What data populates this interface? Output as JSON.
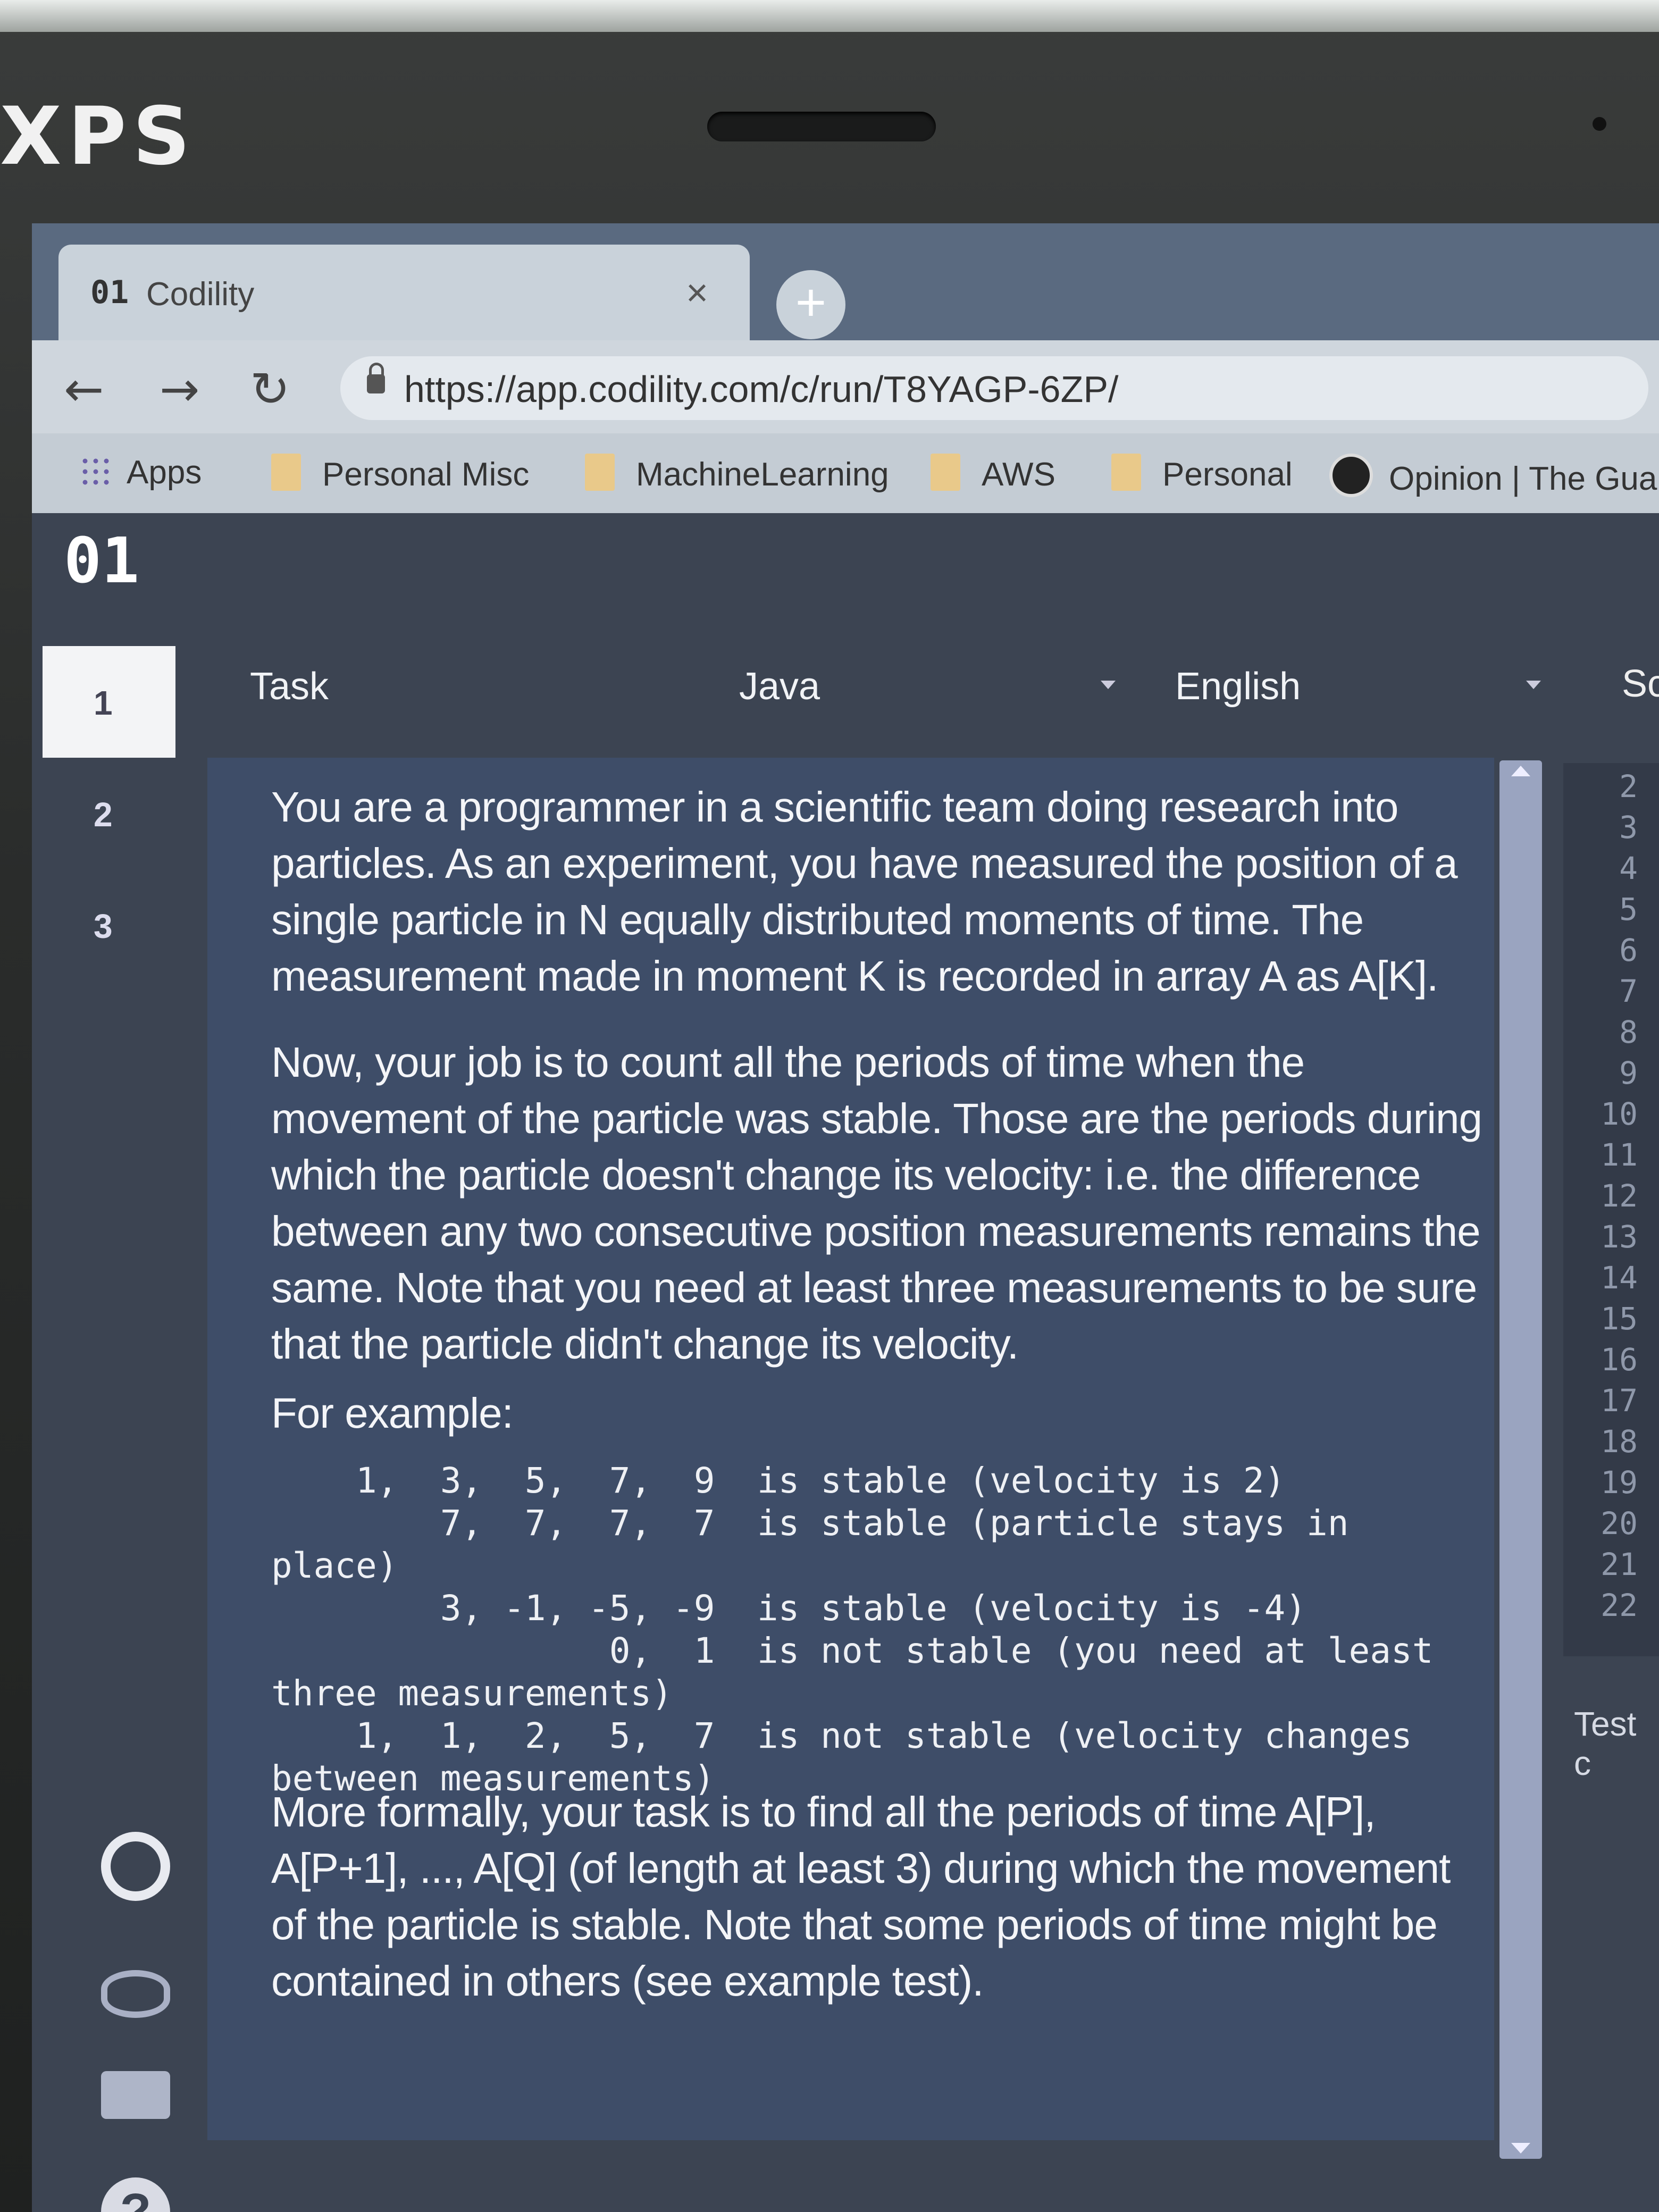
{
  "device": {
    "brand": "XPS"
  },
  "browser": {
    "tab": {
      "favicon_text": "01",
      "title": "Codility"
    },
    "address": {
      "url": "https://app.codility.com/c/run/T8YAGP-6ZP/"
    },
    "bookmarks": [
      "Apps",
      "Personal Misc",
      "MachineLearning",
      "AWS",
      "Personal",
      "Opinion | The Guar"
    ]
  },
  "app": {
    "logo": "01",
    "task_numbers": [
      "1",
      "2",
      "3"
    ],
    "header": {
      "task_label": "Task",
      "language": "Java",
      "locale": "English",
      "right_cut": "Sc"
    },
    "task_text": {
      "p1": "You are a programmer in a scientific team doing research into particles. As an experiment, you have measured the position of a single particle in N equally distributed moments of time. The measurement made in moment K is recorded in array A as A[K].",
      "p2": "Now, your job is to count all the periods of time when the movement of the particle was stable. Those are the periods during which the particle doesn't change its velocity: i.e. the difference between any two consecutive position measurements remains the same. Note that you need at least three measurements to be sure that the particle didn't change its velocity.",
      "p3": "For example:",
      "examples": "    1,  3,  5,  7,  9  is stable (velocity is 2)\n        7,  7,  7,  7  is stable (particle stays in\nplace)\n        3, -1, -5, -9  is stable (velocity is -4)\n                0,  1  is not stable (you need at least\nthree measurements)\n    1,  1,  2,  5,  7  is not stable (velocity changes\nbetween measurements)",
      "p4": "More formally, your task is to find all the periods of time A[P], A[P+1], ..., A[Q] (of length at least 3) during which the movement of the particle is stable. Note that some periods of time might be contained in others (see example test)."
    },
    "line_numbers": [
      "2",
      "3",
      "4",
      "5",
      "6",
      "7",
      "8",
      "9",
      "10",
      "11",
      "12",
      "13",
      "14",
      "15",
      "16",
      "17",
      "18",
      "19",
      "20",
      "21",
      "22"
    ],
    "test_label": "Test c"
  }
}
